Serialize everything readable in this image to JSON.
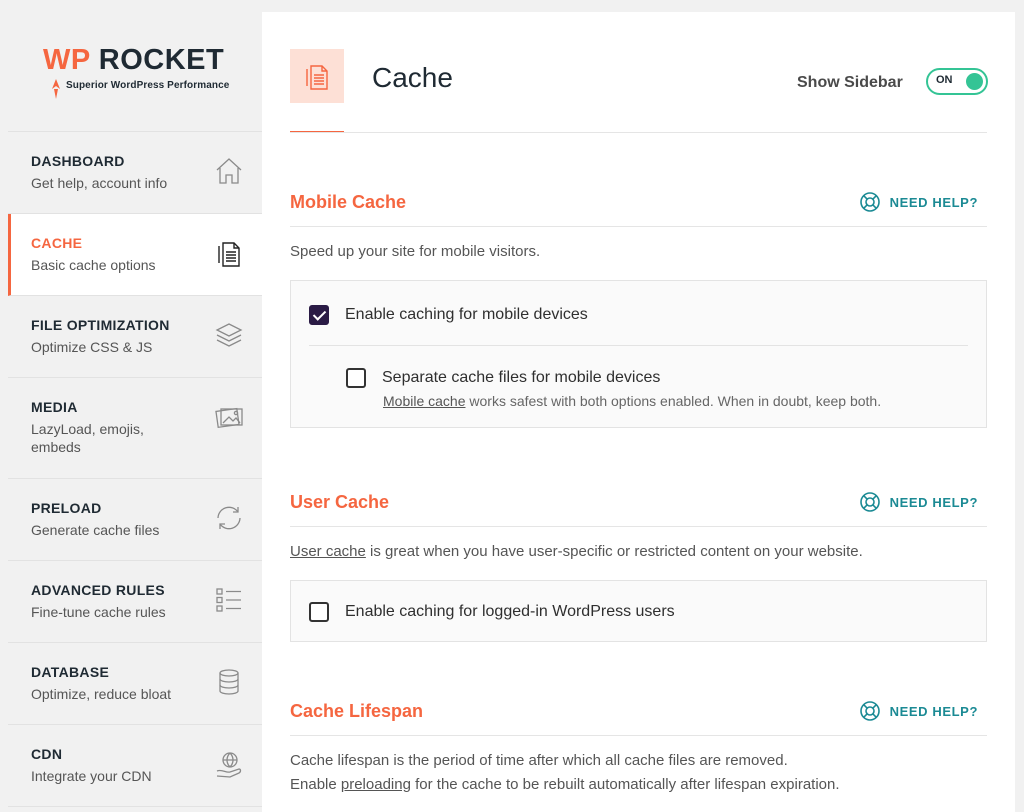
{
  "logo": {
    "brand_prefix": "WP",
    "brand_name": "ROCKET",
    "tagline": "Superior WordPress Performance",
    "accent_color": "#f56640"
  },
  "sidebar": {
    "items": [
      {
        "title": "DASHBOARD",
        "desc": "Get help, account info",
        "icon": "home-icon"
      },
      {
        "title": "CACHE",
        "desc": "Basic cache options",
        "icon": "document-icon",
        "active": true
      },
      {
        "title": "FILE OPTIMIZATION",
        "desc": "Optimize CSS & JS",
        "icon": "layers-icon"
      },
      {
        "title": "MEDIA",
        "desc": "LazyLoad, emojis, embeds",
        "icon": "image-icon"
      },
      {
        "title": "PRELOAD",
        "desc": "Generate cache files",
        "icon": "refresh-icon"
      },
      {
        "title": "ADVANCED RULES",
        "desc": "Fine-tune cache rules",
        "icon": "list-icon"
      },
      {
        "title": "DATABASE",
        "desc": "Optimize, reduce bloat",
        "icon": "database-icon"
      },
      {
        "title": "CDN",
        "desc": "Integrate your CDN",
        "icon": "globe-hand-icon"
      }
    ]
  },
  "header": {
    "title": "Cache",
    "icon": "document-icon",
    "sidebar_toggle_label": "Show Sidebar",
    "toggle_state": "ON",
    "toggle_color": "#34c495"
  },
  "sections": {
    "mobile": {
      "title": "Mobile Cache",
      "help": "NEED HELP?",
      "desc": "Speed up your site for mobile visitors.",
      "opt1": {
        "label": "Enable caching for mobile devices",
        "checked": true
      },
      "opt2": {
        "label": "Separate cache files for mobile devices",
        "checked": false
      },
      "note_link": "Mobile cache",
      "note_rest": " works safest with both options enabled. When in doubt, keep both."
    },
    "user": {
      "title": "User Cache",
      "help": "NEED HELP?",
      "desc_link": "User cache",
      "desc_rest": " is great when you have user-specific or restricted content on your website.",
      "opt1": {
        "label": "Enable caching for logged-in WordPress users",
        "checked": false
      }
    },
    "lifespan": {
      "title": "Cache Lifespan",
      "help": "NEED HELP?",
      "desc_line1": "Cache lifespan is the period of time after which all cache files are removed.",
      "desc_line2_pre": "Enable ",
      "desc_line2_link": "preloading",
      "desc_line2_post": " for the cache to be rebuilt automatically after lifespan expiration."
    }
  }
}
